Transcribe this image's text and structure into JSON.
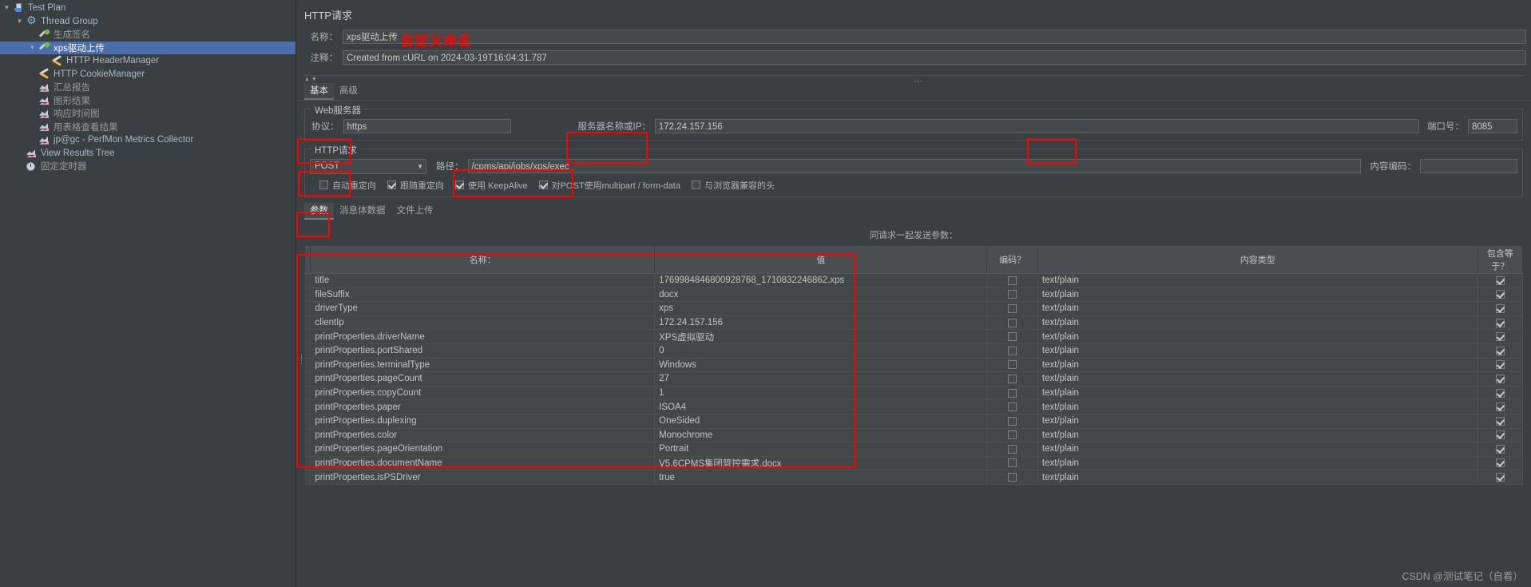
{
  "sidebar": {
    "items": [
      {
        "label": "Test Plan",
        "icon": "flask-icon",
        "depth": 0,
        "twist": "v",
        "selected": false,
        "dim": false
      },
      {
        "label": "Thread Group",
        "icon": "gear-icon",
        "depth": 1,
        "twist": "v",
        "selected": false,
        "dim": false
      },
      {
        "label": "生成签名",
        "icon": "pipette-icon",
        "depth": 2,
        "twist": "",
        "selected": false,
        "dim": true
      },
      {
        "label": "xps驱动上传",
        "icon": "pipette-icon",
        "depth": 2,
        "twist": "v",
        "selected": true,
        "dim": false
      },
      {
        "label": "HTTP HeaderManager",
        "icon": "tools-icon",
        "depth": 3,
        "twist": "",
        "selected": false,
        "dim": false
      },
      {
        "label": "HTTP CookieManager",
        "icon": "tools-icon",
        "depth": 2,
        "twist": "",
        "selected": false,
        "dim": false
      },
      {
        "label": "汇总报告",
        "icon": "chart-icon",
        "depth": 2,
        "twist": "",
        "selected": false,
        "dim": true
      },
      {
        "label": "图形结果",
        "icon": "chart-icon",
        "depth": 2,
        "twist": "",
        "selected": false,
        "dim": true
      },
      {
        "label": "响应时间图",
        "icon": "chart-icon",
        "depth": 2,
        "twist": "",
        "selected": false,
        "dim": true
      },
      {
        "label": "用表格查看结果",
        "icon": "chart-icon",
        "depth": 2,
        "twist": "",
        "selected": false,
        "dim": true
      },
      {
        "label": "jp@gc - PerfMon Metrics Collector",
        "icon": "chart-icon",
        "depth": 2,
        "twist": "",
        "selected": false,
        "dim": false
      },
      {
        "label": "View Results Tree",
        "icon": "chart-icon",
        "depth": 1,
        "twist": "",
        "selected": false,
        "dim": false
      },
      {
        "label": "固定定时器",
        "icon": "clock-icon",
        "depth": 1,
        "twist": "",
        "selected": false,
        "dim": true
      }
    ]
  },
  "panel": {
    "title": "HTTP请求",
    "name_label": "名称：",
    "name_value": "xps驱动上传",
    "comment_label": "注释：",
    "comment_value": "Created from cURL on 2024-03-19T16:04:31.787",
    "annotation_custom_name": "自定义命名"
  },
  "tabs": [
    {
      "label": "基本",
      "active": true
    },
    {
      "label": "高级",
      "active": false
    }
  ],
  "webserver": {
    "group_title": "Web服务器",
    "protocol_label": "协议：",
    "protocol_value": "https",
    "server_label": "服务器名称或IP：",
    "server_value": "172.24.157.156",
    "port_label": "端口号：",
    "port_value": "8085"
  },
  "httprequest": {
    "group_title": "HTTP请求",
    "method_value": "POST",
    "path_label": "路径：",
    "path_value": "/cpms/api/jobs/xps/exec",
    "encoding_label": "内容编码：",
    "encoding_value": "",
    "checkboxes": [
      {
        "label": "自动重定向",
        "checked": false
      },
      {
        "label": "跟随重定向",
        "checked": true
      },
      {
        "label": "使用 KeepAlive",
        "checked": true
      },
      {
        "label": "对POST使用multipart / form-data",
        "checked": true
      },
      {
        "label": "与浏览器兼容的头",
        "checked": false
      }
    ]
  },
  "param_tabs": [
    {
      "label": "参数",
      "active": true
    },
    {
      "label": "消息体数据",
      "active": false
    },
    {
      "label": "文件上传",
      "active": false
    }
  ],
  "table": {
    "send_note": "同请求一起发送参数：",
    "headers": [
      "",
      "名称：",
      "值",
      "编码？",
      "内容类型",
      "包含等于？"
    ],
    "rows": [
      {
        "name": "title",
        "value": "1769984846800928768_1710832246862.xps",
        "encode": false,
        "type": "text/plain",
        "equals": true
      },
      {
        "name": "fileSuffix",
        "value": "docx",
        "encode": false,
        "type": "text/plain",
        "equals": true
      },
      {
        "name": "driverType",
        "value": "xps",
        "encode": false,
        "type": "text/plain",
        "equals": true
      },
      {
        "name": "clientIp",
        "value": "172.24.157.156",
        "encode": false,
        "type": "text/plain",
        "equals": true
      },
      {
        "name": "printProperties.driverName",
        "value": "XPS虚拟驱动",
        "encode": false,
        "type": "text/plain",
        "equals": true
      },
      {
        "name": "printProperties.portShared",
        "value": "0",
        "encode": false,
        "type": "text/plain",
        "equals": true
      },
      {
        "name": "printProperties.terminalType",
        "value": "Windows",
        "encode": false,
        "type": "text/plain",
        "equals": true
      },
      {
        "name": "printProperties.pageCount",
        "value": "27",
        "encode": false,
        "type": "text/plain",
        "equals": true
      },
      {
        "name": "printProperties.copyCount",
        "value": "1",
        "encode": false,
        "type": "text/plain",
        "equals": true
      },
      {
        "name": "printProperties.paper",
        "value": "ISOA4",
        "encode": false,
        "type": "text/plain",
        "equals": true
      },
      {
        "name": "printProperties.duplexing",
        "value": "OneSided",
        "encode": false,
        "type": "text/plain",
        "equals": true
      },
      {
        "name": "printProperties.color",
        "value": "Monochrome",
        "encode": false,
        "type": "text/plain",
        "equals": true
      },
      {
        "name": "printProperties.pageOrientation",
        "value": "Portrait",
        "encode": false,
        "type": "text/plain",
        "equals": true
      },
      {
        "name": "printProperties.documentName",
        "value": "V5.6CPMS集团管控需求.docx",
        "encode": false,
        "type": "text/plain",
        "equals": true
      },
      {
        "name": "printProperties.isPSDriver",
        "value": "true",
        "encode": false,
        "type": "text/plain",
        "equals": true
      }
    ]
  },
  "watermark": "CSDN @测试笔记（自看）",
  "colors": {
    "selection": "#4a6ea9",
    "annotation": "#ff0000",
    "background": "#3c3f41"
  }
}
